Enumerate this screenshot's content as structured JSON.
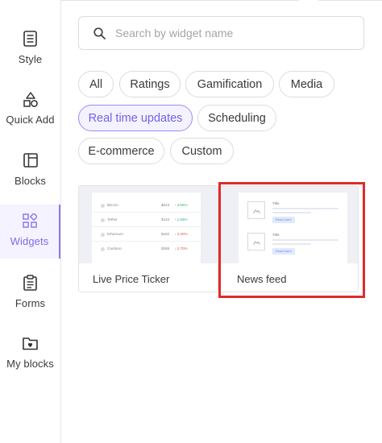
{
  "sidebar": {
    "items": [
      {
        "label": "Style",
        "icon": "style-doc-icon"
      },
      {
        "label": "Quick Add",
        "icon": "shapes-icon"
      },
      {
        "label": "Blocks",
        "icon": "blocks-layout-icon"
      },
      {
        "label": "Widgets",
        "icon": "widgets-grid-icon",
        "active": true
      },
      {
        "label": "Forms",
        "icon": "clipboard-icon"
      },
      {
        "label": "My blocks",
        "icon": "folder-heart-icon"
      }
    ]
  },
  "search": {
    "placeholder": "Search by widget name",
    "value": ""
  },
  "categories": [
    {
      "label": "All"
    },
    {
      "label": "Ratings"
    },
    {
      "label": "Gamification"
    },
    {
      "label": "Media"
    },
    {
      "label": "Real time updates",
      "active": true
    },
    {
      "label": "Scheduling"
    },
    {
      "label": "E-commerce"
    },
    {
      "label": "Custom"
    }
  ],
  "widgets": [
    {
      "title": "Live Price Ticker",
      "preview": {
        "rows": [
          {
            "name": "Bitcoin",
            "price": "$543",
            "change": "↑ 3.56%",
            "direction": "up"
          },
          {
            "name": "Tether",
            "price": "$442",
            "change": "↑ 1.56%",
            "direction": "up"
          },
          {
            "name": "Ethereum",
            "price": "$482",
            "change": "↓ 3.30%",
            "direction": "down"
          },
          {
            "name": "Cardano",
            "price": "$388",
            "change": "↓ 2.70%",
            "direction": "down"
          }
        ]
      }
    },
    {
      "title": "News feed",
      "highlighted": true,
      "preview": {
        "items": [
          {
            "title": "Title",
            "button": "Read more"
          },
          {
            "title": "Title",
            "button": "Read more"
          }
        ]
      }
    }
  ],
  "colors": {
    "accent": "#8a7bf0",
    "highlight": "#e02b2b",
    "up": "#34b36b",
    "down": "#e05a4e"
  }
}
